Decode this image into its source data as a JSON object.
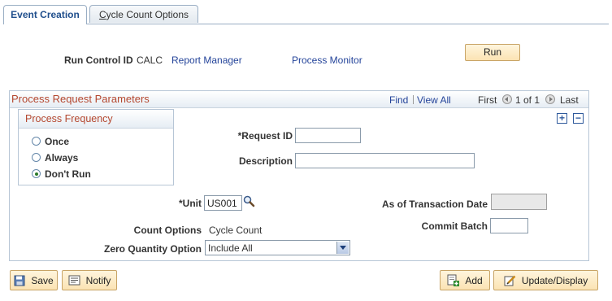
{
  "tabs": [
    {
      "label": "Event Creation",
      "active": true
    },
    {
      "label_first": "C",
      "label_rest": "ycle Count Options",
      "active": false
    }
  ],
  "run_control": {
    "label": "Run Control ID",
    "value": "CALC",
    "report_manager": "Report Manager",
    "process_monitor": "Process Monitor",
    "run_button": "Run"
  },
  "panel": {
    "title": "Process Request Parameters",
    "find": "Find",
    "view_all": "View All",
    "first": "First",
    "counter": "1 of 1",
    "last": "Last",
    "add_row": "+",
    "delete_row": "−"
  },
  "frequency": {
    "title": "Process Frequency",
    "options": [
      {
        "label": "Once",
        "selected": false
      },
      {
        "label": "Always",
        "selected": false
      },
      {
        "label": "Don't Run",
        "selected": true
      }
    ]
  },
  "fields": {
    "request_id_label": "*Request ID",
    "request_id_value": "",
    "description_label": "Description",
    "description_value": "",
    "unit_label": "*Unit",
    "unit_value": "US001",
    "as_of_date_label": "As of Transaction Date",
    "as_of_date_value": "",
    "count_options_label": "Count Options",
    "count_options_value": "Cycle Count",
    "commit_batch_label": "Commit Batch",
    "commit_batch_value": "",
    "zero_qty_label": "Zero Quantity Option",
    "zero_qty_value": "Include All"
  },
  "footer": {
    "save": "Save",
    "notify": "Notify",
    "add": "Add",
    "update_display": "Update/Display"
  },
  "colors": {
    "link": "#24449a",
    "section_title": "#b4472f",
    "button_fill": "#fbe3b3"
  }
}
